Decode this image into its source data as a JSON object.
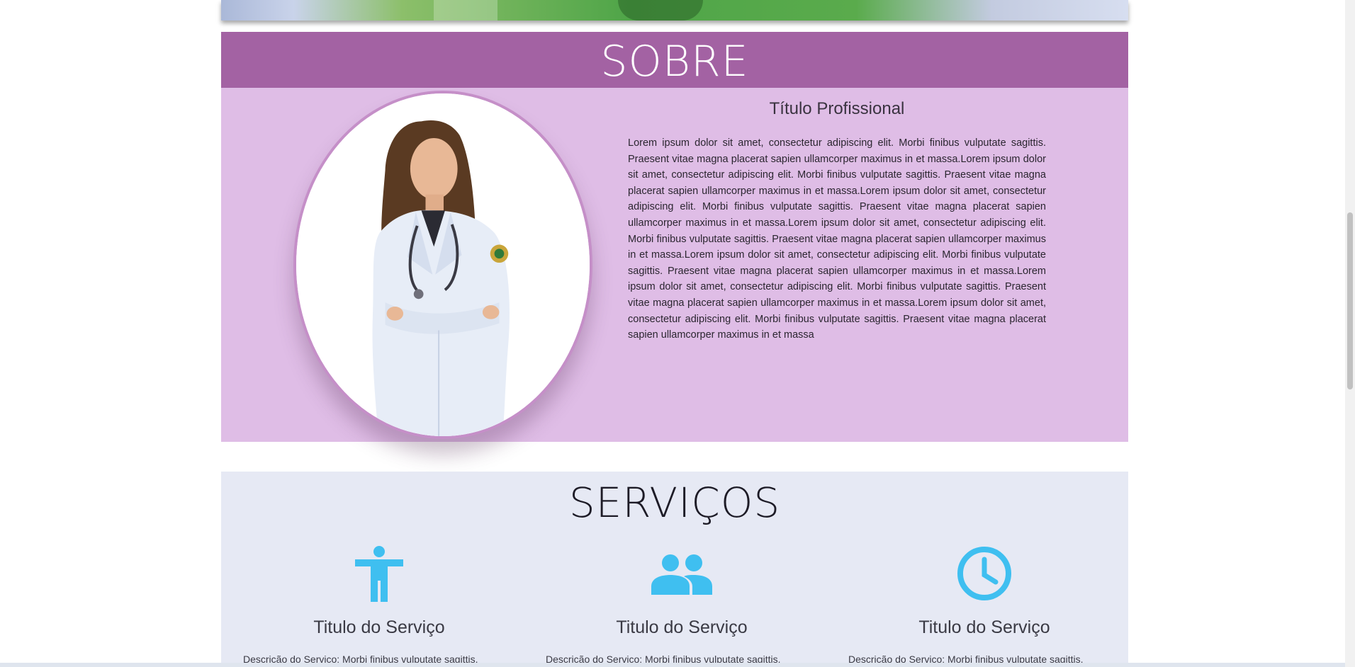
{
  "sobre": {
    "heading": "SOBRE",
    "title": "Título Profissional",
    "text": "Lorem ipsum dolor sit amet, consectetur adipiscing elit. Morbi finibus vulputate sagittis. Praesent vitae magna placerat sapien ullamcorper maximus in et massa.Lorem ipsum dolor sit amet, consectetur adipiscing elit. Morbi finibus vulputate sagittis. Praesent vitae magna placerat sapien ullamcorper maximus in et massa.Lorem ipsum dolor sit amet, consectetur adipiscing elit. Morbi finibus vulputate sagittis. Praesent vitae magna placerat sapien ullamcorper maximus in et massa.Lorem ipsum dolor sit amet, consectetur adipiscing elit. Morbi finibus vulputate sagittis. Praesent vitae magna placerat sapien ullamcorper maximus in et massa.Lorem ipsum dolor sit amet, consectetur adipiscing elit. Morbi finibus vulputate sagittis. Praesent vitae magna placerat sapien ullamcorper maximus in et massa.Lorem ipsum dolor sit amet, consectetur adipiscing elit. Morbi finibus vulputate sagittis. Praesent vitae magna placerat sapien ullamcorper maximus in et massa.Lorem ipsum dolor sit amet, consectetur adipiscing elit. Morbi finibus vulputate sagittis. Praesent vitae magna placerat sapien ullamcorper maximus in et massa"
  },
  "servicos": {
    "heading": "SERVIÇOS",
    "items": [
      {
        "icon": "accessibility-icon",
        "title": "Titulo do Serviço",
        "desc": "Descrição do Serviço: Morbi finibus vulputate sagittis."
      },
      {
        "icon": "people-icon",
        "title": "Titulo do Serviço",
        "desc": "Descrição do Serviço: Morbi finibus vulputate sagittis."
      },
      {
        "icon": "clock-icon",
        "title": "Titulo do Serviço",
        "desc": "Descrição do Serviço: Morbi finibus vulputate sagittis."
      }
    ]
  },
  "colors": {
    "header_purple": "#a362a3",
    "body_lilac": "#dfbde6",
    "services_bg": "#e6e9f4",
    "icon_blue": "#3fbff0"
  }
}
